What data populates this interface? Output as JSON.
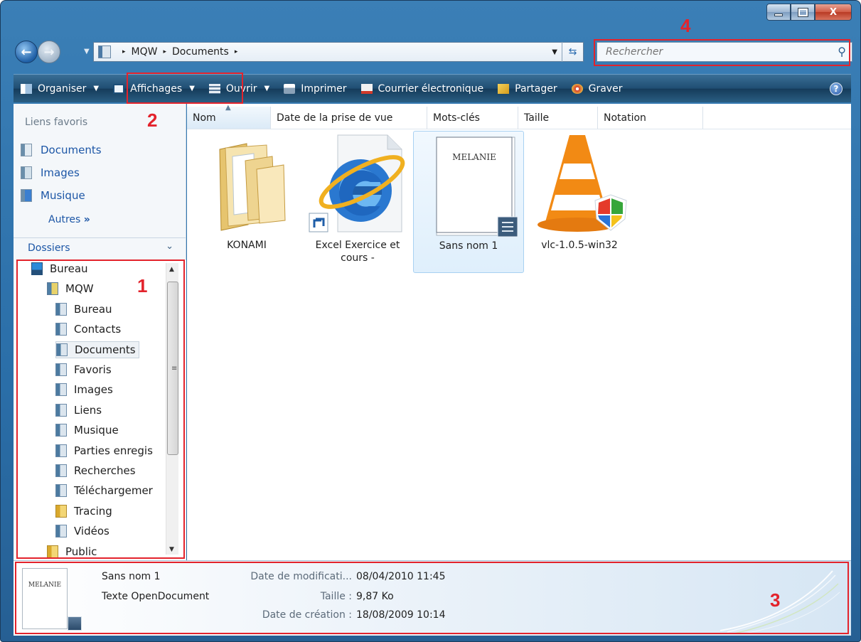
{
  "window": {
    "caption_buttons": {
      "minimize": "minimize-icon",
      "maximize": "maximize-icon",
      "close": "X"
    }
  },
  "address": {
    "path": [
      "MQW",
      "Documents"
    ],
    "separator": "▸"
  },
  "search": {
    "placeholder": "Rechercher"
  },
  "toolbar": {
    "items": [
      {
        "label": "Organiser",
        "dropdown": true,
        "icon": "organize-icon"
      },
      {
        "label": "Affichages",
        "dropdown": true,
        "icon": "views-icon"
      },
      {
        "label": "Ouvrir",
        "dropdown": true,
        "icon": "open-icon"
      },
      {
        "label": "Imprimer",
        "dropdown": false,
        "icon": "print-icon"
      },
      {
        "label": "Courrier électronique",
        "dropdown": false,
        "icon": "email-icon"
      },
      {
        "label": "Partager",
        "dropdown": false,
        "icon": "share-icon"
      },
      {
        "label": "Graver",
        "dropdown": false,
        "icon": "burn-icon"
      }
    ],
    "help": "?"
  },
  "favorites": {
    "title": "Liens favoris",
    "items": [
      "Documents",
      "Images",
      "Musique"
    ],
    "more": "Autres",
    "more_glyph": "»"
  },
  "folders": {
    "title": "Dossiers",
    "tree": [
      {
        "label": "Bureau",
        "level": 0
      },
      {
        "label": "MQW",
        "level": 1
      },
      {
        "label": "Bureau",
        "level": 2
      },
      {
        "label": "Contacts",
        "level": 2
      },
      {
        "label": "Documents",
        "level": 2,
        "selected": true
      },
      {
        "label": "Favoris",
        "level": 2
      },
      {
        "label": "Images",
        "level": 2
      },
      {
        "label": "Liens",
        "level": 2
      },
      {
        "label": "Musique",
        "level": 2
      },
      {
        "label": "Parties enregis",
        "level": 2
      },
      {
        "label": "Recherches",
        "level": 2
      },
      {
        "label": "Téléchargemer",
        "level": 2
      },
      {
        "label": "Tracing",
        "level": 2
      },
      {
        "label": "Vidéos",
        "level": 2
      },
      {
        "label": "Public",
        "level": 1
      }
    ]
  },
  "columns": [
    "Nom",
    "Date de la prise de vue",
    "Mots-clés",
    "Taille",
    "Notation"
  ],
  "files": [
    {
      "name": "KONAMI",
      "type": "folder-icon"
    },
    {
      "name": "Excel Exercice et cours -",
      "type": "internet-shortcut-icon"
    },
    {
      "name": "Sans nom 1",
      "type": "opendocument-text-icon",
      "selected": true,
      "thumb_text": "MELANIE"
    },
    {
      "name": "vlc-1.0.5-win32",
      "type": "vlc-installer-icon"
    }
  ],
  "details": {
    "thumb_text": "MELANIE",
    "name": "Sans nom 1",
    "type": "Texte OpenDocument",
    "fields": [
      {
        "label": "Date de modificati...",
        "value": "08/04/2010 11:45"
      },
      {
        "label": "Taille :",
        "value": "9,87 Ko"
      },
      {
        "label": "Date de création :",
        "value": "18/08/2009 10:14"
      }
    ]
  },
  "annotations": [
    "1",
    "2",
    "3",
    "4"
  ],
  "colors": {
    "annotation": "#e3232c",
    "toolbar": "#1f4d72",
    "link": "#1c56a6"
  }
}
